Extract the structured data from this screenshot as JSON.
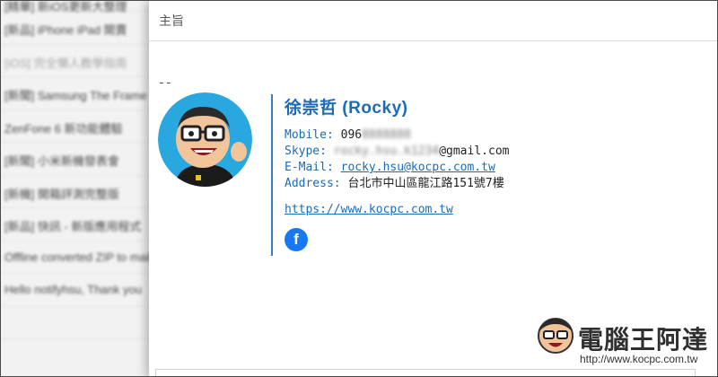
{
  "background_list": {
    "rows": [
      "[精華] 新iOS更新大整理",
      "[新品] iPhone iPad 開賣",
      "[iOS] 完全懶人教學指南",
      "[新聞] Samsung The Frame",
      "ZenFone 6 新功能體驗",
      "[新聞] 小米新機發表會",
      "[新機] 開箱評測完整版",
      "[新品] 快訊 - 新版應用程式",
      "Offline converted ZIP to mail",
      "Hello notifyhsu, Thank you"
    ]
  },
  "compose": {
    "subject_label": "主旨",
    "separator": "--"
  },
  "signature": {
    "name": "徐崇哲 (Rocky)",
    "mobile_label": "Mobile:",
    "mobile_visible": "096",
    "mobile_hidden": "8888888",
    "skype_label": "Skype:",
    "skype_hidden": "rocky.hsu.k1234",
    "skype_visible": "@gmail.com",
    "email_label": "E-Mail:",
    "email": "rocky.hsu@kocpc.com.tw",
    "address_label": "Address:",
    "address": "台北市中山區龍江路151號7樓",
    "website": "https://www.kocpc.com.tw",
    "facebook_glyph": "f"
  },
  "watermark": {
    "title": "電腦王阿達",
    "url": "http://www.kocpc.com.tw"
  },
  "colors": {
    "accent": "#1c6bb8",
    "facebook": "#1877f2",
    "avatar_bg": "#29a8e0"
  }
}
